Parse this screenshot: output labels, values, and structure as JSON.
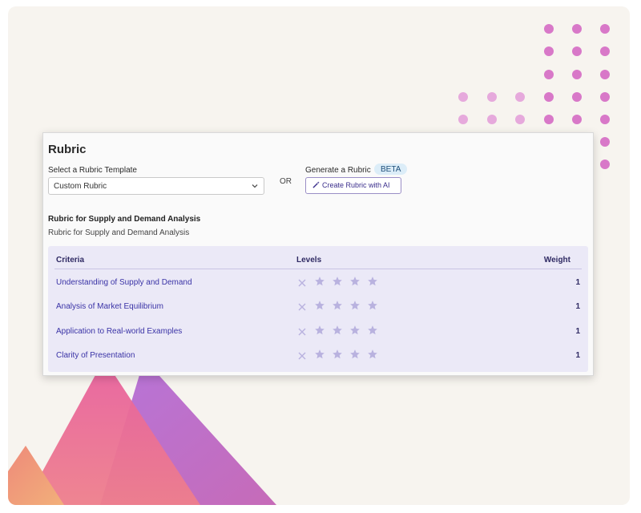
{
  "card": {
    "title": "Rubric",
    "template_label": "Select a Rubric Template",
    "template_selected": "Custom Rubric",
    "or_text": "OR",
    "generate_label": "Generate a Rubric",
    "beta_badge": "BETA",
    "ai_button_label": "Create Rubric with AI",
    "rubric_title": "Rubric for Supply and Demand Analysis",
    "rubric_description": "Rubric for Supply and Demand Analysis"
  },
  "table": {
    "headers": {
      "criteria": "Criteria",
      "levels": "Levels",
      "weight": "Weight"
    },
    "rows": [
      {
        "criteria": "Understanding of Supply and Demand",
        "weight": "1"
      },
      {
        "criteria": "Analysis of Market Equilibrium",
        "weight": "1"
      },
      {
        "criteria": "Application to Real-world Examples",
        "weight": "1"
      },
      {
        "criteria": "Clarity of Presentation",
        "weight": "1"
      }
    ]
  },
  "icons": {
    "level_clear": "x-icon",
    "level_star": "star-icon",
    "ai_button": "magic-wand-icon",
    "dropdown": "chevron-down-icon"
  },
  "colors": {
    "accent": "#3a33a6",
    "table_bg": "#ebe9f7",
    "star": "#b9b2df",
    "dots": "#d878c8",
    "beta_bg": "#dcedf8"
  }
}
